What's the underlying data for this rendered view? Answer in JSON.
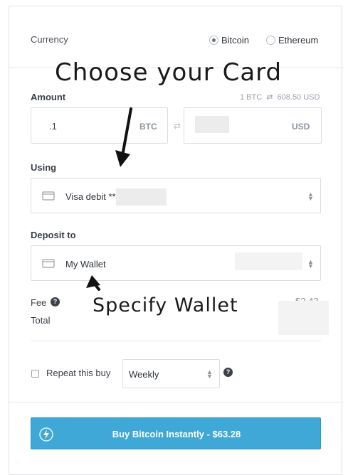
{
  "currency": {
    "label": "Currency",
    "options": [
      {
        "label": "Bitcoin",
        "selected": true
      },
      {
        "label": "Ethereum",
        "selected": false
      }
    ]
  },
  "annotations": {
    "choose_card": "Choose your Card",
    "specify_wallet": "Specify Wallet"
  },
  "amount": {
    "label": "Amount",
    "rate_left": "1 BTC",
    "rate_swap": "⇄",
    "rate_right": "608.50 USD",
    "crypto_value": ".1",
    "crypto_unit": "BTC",
    "fields_swap": "⇄",
    "fiat_unit": "USD"
  },
  "using": {
    "label": "Using",
    "selected": "Visa debit **"
  },
  "deposit": {
    "label": "Deposit to",
    "selected": "My Wallet"
  },
  "fee": {
    "fee_label": "Fee",
    "fee_help": "?",
    "fee_value": "$2.43",
    "total_label": "Total"
  },
  "repeat": {
    "label": "Repeat this buy",
    "frequency": "Weekly",
    "help": "?"
  },
  "buy_button": {
    "label": "Buy Bitcoin Instantly - $63.28"
  },
  "colors": {
    "button": "#3fa8d6",
    "border": "#dfe2e6"
  }
}
